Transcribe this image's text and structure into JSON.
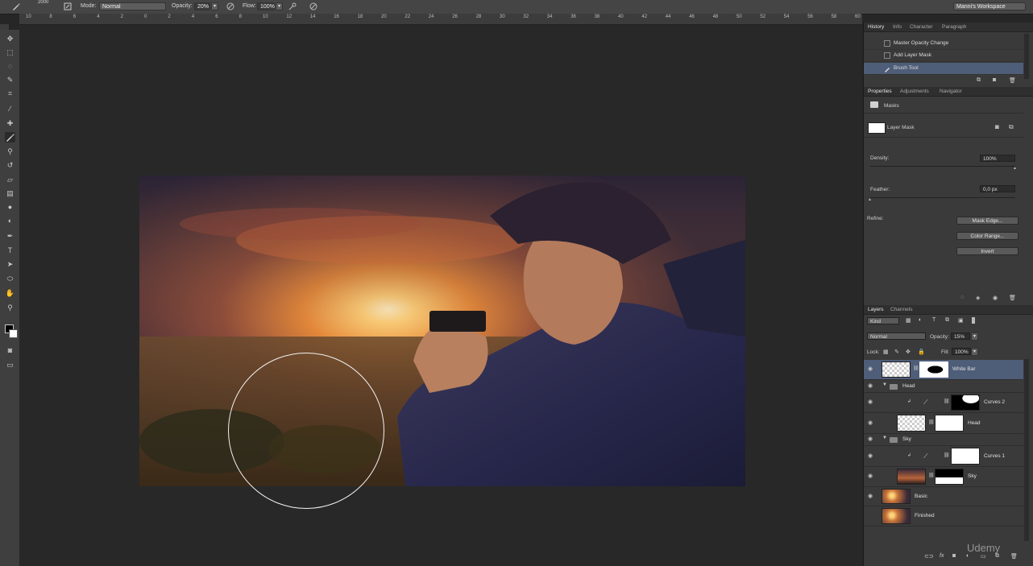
{
  "options_bar": {
    "brush_size": "2000",
    "mode_label": "Mode:",
    "mode_value": "Normal",
    "opacity_label": "Opacity:",
    "opacity_value": "20%",
    "flow_label": "Flow:",
    "flow_value": "100%",
    "workspace": "Manni's Workspace"
  },
  "ruler_top_numbers": [
    "10",
    "8",
    "6",
    "4",
    "2",
    "0",
    "2",
    "4",
    "6",
    "8",
    "10",
    "12",
    "14",
    "16",
    "18",
    "20",
    "22",
    "24",
    "26",
    "28",
    "30",
    "32",
    "34",
    "36",
    "38",
    "40",
    "42",
    "44",
    "46",
    "48",
    "50",
    "52",
    "54",
    "56",
    "58",
    "60"
  ],
  "history_panel": {
    "tabs": [
      "History",
      "Info",
      "Character",
      "Paragraph"
    ],
    "items": [
      {
        "label": "Master Opacity Change",
        "selected": false
      },
      {
        "label": "Add Layer Mask",
        "selected": false
      },
      {
        "label": "Brush Tool",
        "selected": true
      }
    ]
  },
  "properties_panel": {
    "tabs": [
      "Properties",
      "Adjustments",
      "Navigator"
    ],
    "section": "Masks",
    "mask_type": "Layer Mask",
    "density_label": "Density:",
    "density_value": "100%",
    "density_level": 1.0,
    "feather_label": "Feather:",
    "feather_value": "0,0 px",
    "feather_level": 0.0,
    "refine_label": "Refine:",
    "buttons": [
      "Mask Edge...",
      "Color Range...",
      "Invert"
    ]
  },
  "layers_panel": {
    "tabs": [
      "Layers",
      "Channels"
    ],
    "filter": "Kind",
    "blend_mode": "Normal",
    "opacity_label": "Opacity:",
    "opacity_value": "15%",
    "lock_label": "Lock:",
    "fill_label": "Fill:",
    "fill_value": "100%",
    "layers": [
      {
        "name": "White Bar",
        "kind": "layer-mask",
        "selected": true
      },
      {
        "name": "Head",
        "kind": "group"
      },
      {
        "name": "Curves 2",
        "kind": "adjustment"
      },
      {
        "name": "Head",
        "kind": "layer-mask"
      },
      {
        "name": "Sky",
        "kind": "group"
      },
      {
        "name": "Curves 1",
        "kind": "adjustment"
      },
      {
        "name": "Sky",
        "kind": "layer-mask"
      },
      {
        "name": "Basic",
        "kind": "image"
      },
      {
        "name": "Finished",
        "kind": "image",
        "hidden": true
      }
    ]
  },
  "watermark": "Udemy",
  "colors": {
    "selection": "#4e5d78",
    "panel_bg": "#3a3a3a",
    "canvas_bg": "#282828"
  }
}
